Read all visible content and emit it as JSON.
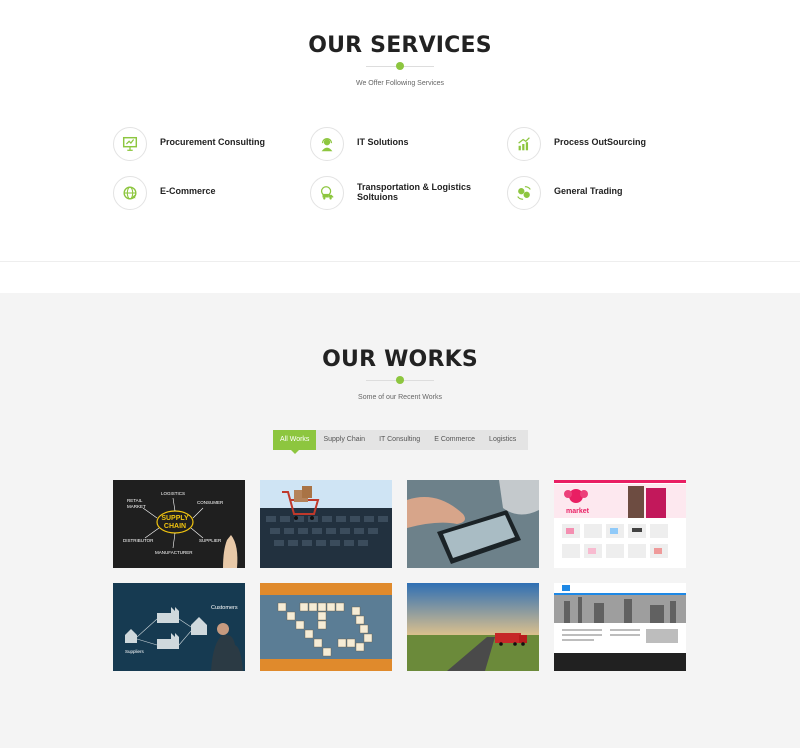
{
  "services_section": {
    "title": "OUR SERVICES",
    "subtitle": "We Offer Following Services",
    "items": [
      {
        "label": "Procurement Consulting",
        "icon": "presentation-icon"
      },
      {
        "label": "IT Solutions",
        "icon": "support-agent-icon"
      },
      {
        "label": "Process OutSourcing",
        "icon": "growth-chart-icon"
      },
      {
        "label": "E-Commerce",
        "icon": "globe-icon"
      },
      {
        "label": "Transportation & Logistics Soltuions",
        "icon": "delivery-truck-icon"
      },
      {
        "label": "General Trading",
        "icon": "money-exchange-icon"
      }
    ]
  },
  "works_section": {
    "title": "OUR WORKS",
    "subtitle": "Some of our Recent Works",
    "filters": [
      "All Works",
      "Supply Chain",
      "IT Consulting",
      "E Commerce",
      "Logistics"
    ],
    "active_filter": "All Works",
    "thumbnail_text": {
      "supply_chain": [
        "SUPPLY",
        "CHAIN"
      ],
      "supply_words": [
        "LOGISTICS",
        "RETAIL",
        "MARKET",
        "CONSUMER",
        "DISTRIBUTOR",
        "MANUFACTURER",
        "SUPPLIER"
      ],
      "market": "market",
      "customers": "Customers",
      "suppliers": "Suppliers"
    }
  },
  "colors": {
    "accent": "#8dc63f",
    "text": "#222222",
    "section_bg": "#f4f4f4"
  }
}
